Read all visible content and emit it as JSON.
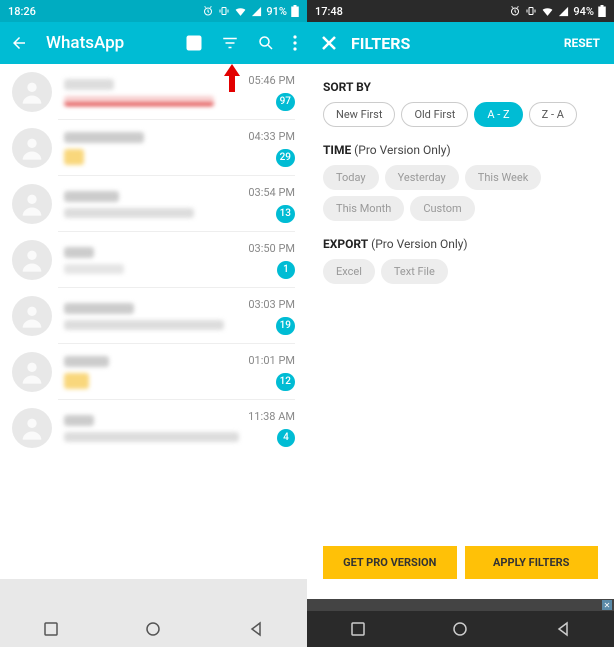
{
  "left": {
    "status": {
      "time": "18:26",
      "battery": "91%"
    },
    "appbar": {
      "title": "WhatsApp"
    },
    "chats": [
      {
        "time": "05:46 PM",
        "badge": "97"
      },
      {
        "time": "04:33 PM",
        "badge": "29"
      },
      {
        "time": "03:54 PM",
        "badge": "13"
      },
      {
        "time": "03:50 PM",
        "badge": "1"
      },
      {
        "time": "03:03 PM",
        "badge": "19"
      },
      {
        "time": "01:01 PM",
        "badge": "12"
      },
      {
        "time": "11:38 AM",
        "badge": "4"
      }
    ]
  },
  "right": {
    "status": {
      "time": "17:48",
      "battery": "94%"
    },
    "filterbar": {
      "title": "FILTERS",
      "reset": "RESET"
    },
    "sort": {
      "title": "SORT BY",
      "opts": {
        "newfirst": "New First",
        "oldfirst": "Old First",
        "az": "A - Z",
        "za": "Z - A"
      }
    },
    "time": {
      "title": "TIME",
      "sub": " (Pro Version Only)",
      "opts": {
        "today": "Today",
        "yesterday": "Yesterday",
        "thisweek": "This Week",
        "thismonth": "This Month",
        "custom": "Custom"
      }
    },
    "export": {
      "title": "EXPORT",
      "sub": " (Pro Version Only)",
      "opts": {
        "excel": "Excel",
        "textfile": "Text File"
      }
    },
    "buttons": {
      "getpro": "GET PRO VERSION",
      "apply": "APPLY FILTERS"
    }
  }
}
